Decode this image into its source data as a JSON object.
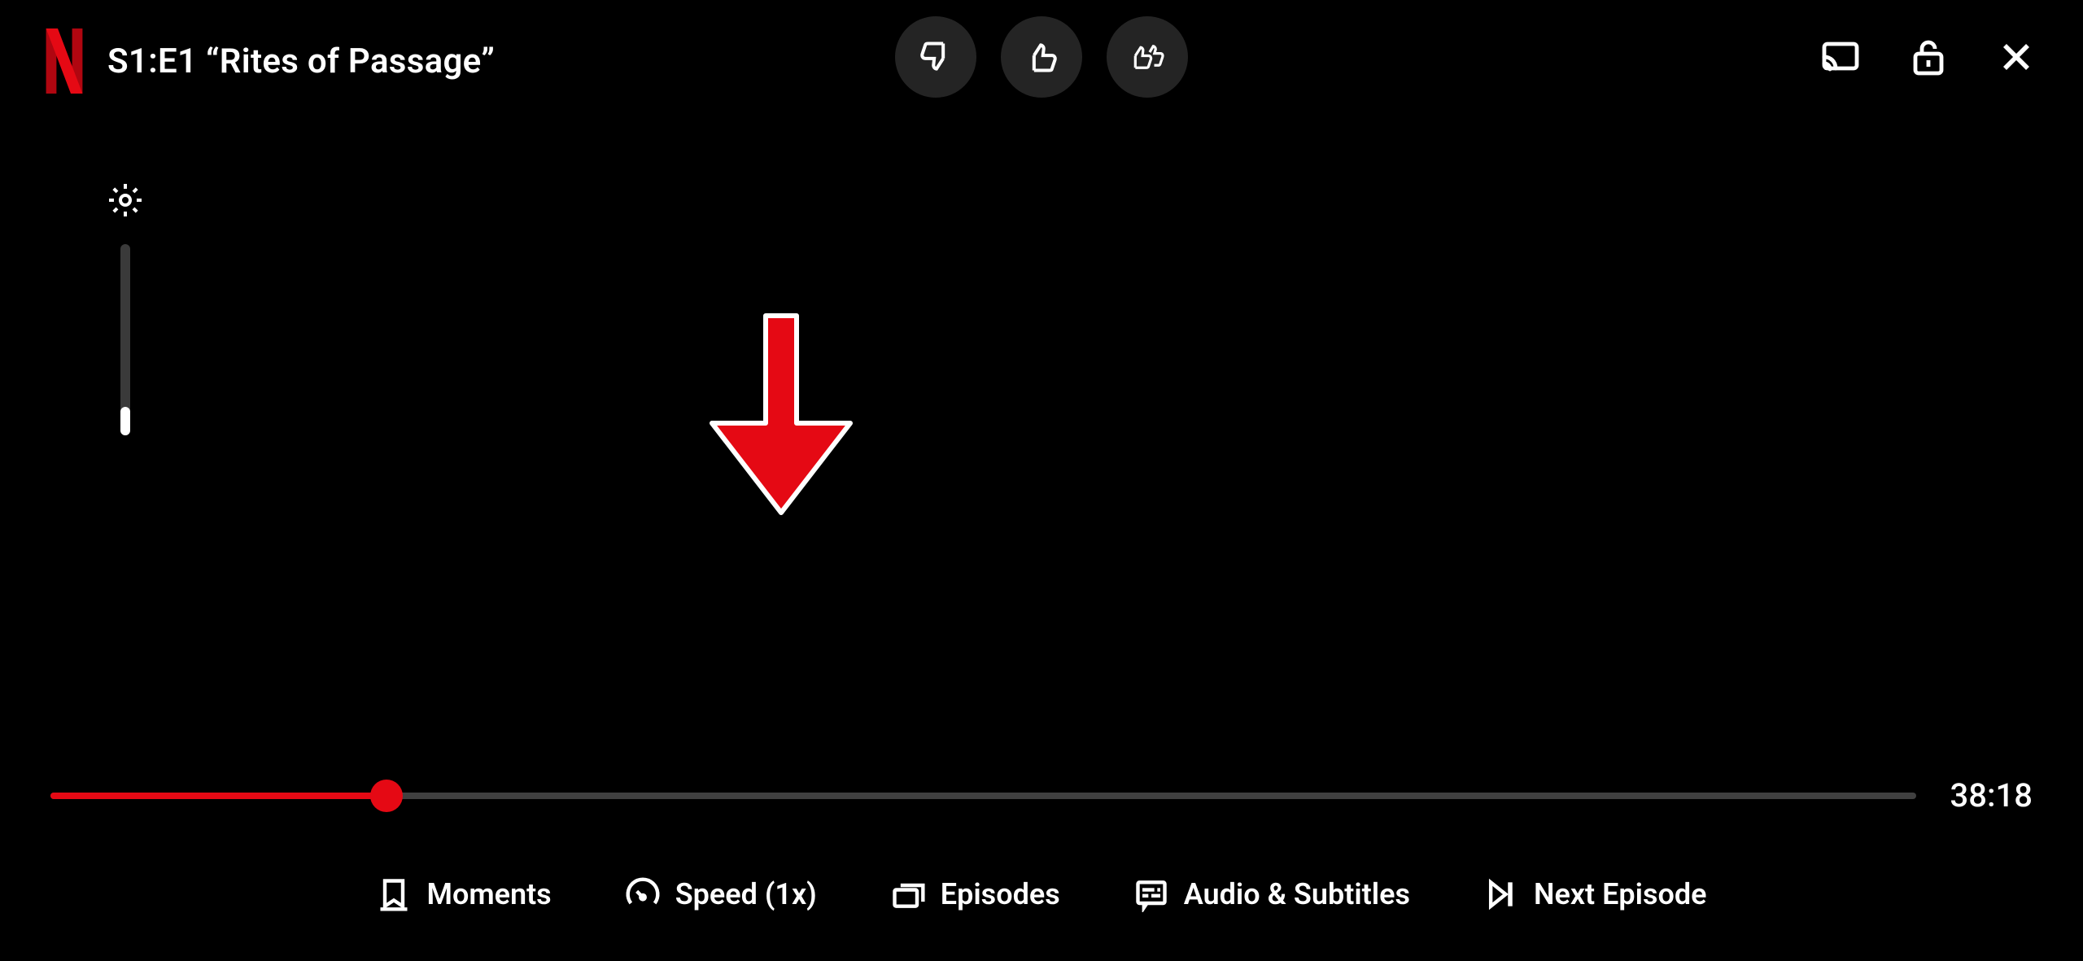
{
  "header": {
    "episode_title": "S1:E1 “Rites of Passage”"
  },
  "rating": {
    "dislike_icon": "thumbs-down",
    "like_icon": "thumbs-up",
    "love_icon": "double-thumbs-up"
  },
  "top_right": {
    "cast_icon": "cast",
    "lock_icon": "unlock",
    "close_icon": "close"
  },
  "brightness": {
    "level_percent": 15
  },
  "progress": {
    "percent": 18,
    "time_remaining": "38:18"
  },
  "controls": {
    "moments": "Moments",
    "speed": "Speed (1x)",
    "episodes": "Episodes",
    "audio_subtitles": "Audio & Subtitles",
    "next_episode": "Next Episode"
  },
  "annotation": {
    "arrow_color": "#e50914",
    "points_to": "audio_subtitles"
  }
}
